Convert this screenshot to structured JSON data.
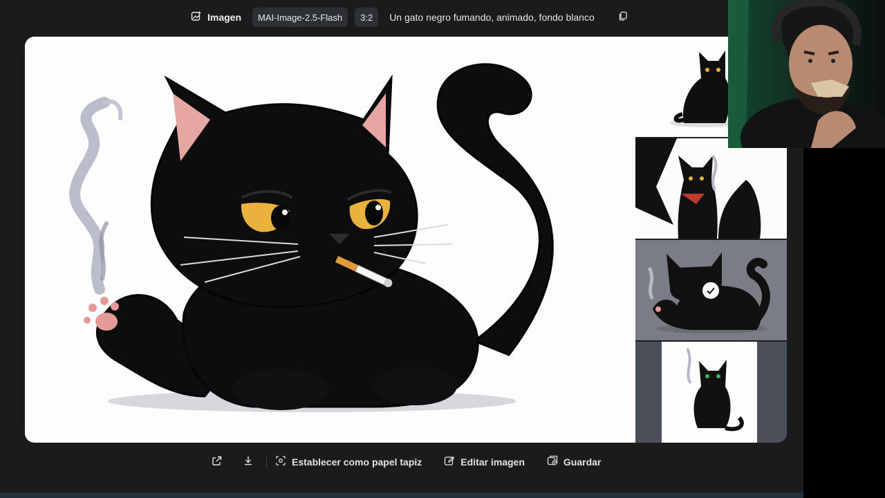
{
  "header": {
    "type_label": "Imagen",
    "model": "MAI-Image-2.5-Flash",
    "aspect": "3:2",
    "prompt": "Un gato negro fumando, animado, fondo blanco"
  },
  "icons": {
    "type": "image-spark-icon",
    "copy": "copy-icon",
    "share": "share-icon",
    "download": "download-icon",
    "wallpaper": "wallpaper-icon",
    "edit": "edit-image-icon",
    "save": "save-icon",
    "selected": "checkmark-icon"
  },
  "thumbnails": [
    {
      "description": "cat-sitting",
      "selected": false
    },
    {
      "description": "cat-with-bandana",
      "selected": false
    },
    {
      "description": "cat-lying-smoking",
      "selected": true
    },
    {
      "description": "cat-sitting-green-eyes",
      "selected": false
    }
  ],
  "toolbar": {
    "wallpaper_label": "Establecer como papel tapiz",
    "edit_label": "Editar imagen",
    "save_label": "Guardar"
  },
  "colors": {
    "app_bg": "#1b1b1b",
    "chip_bg": "#2c2f33",
    "cat_eye": "#e8b23c",
    "paw_pink": "#e59a98"
  }
}
